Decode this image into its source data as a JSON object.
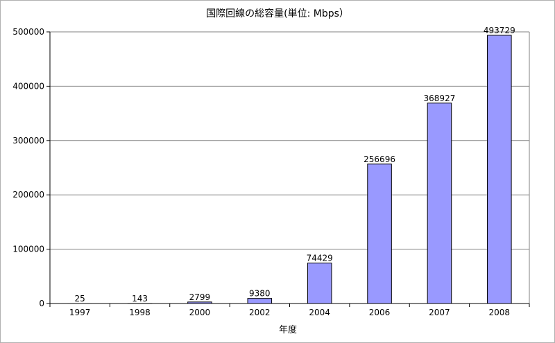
{
  "chart_data": {
    "type": "bar",
    "title": "国際回線の総容量(単位: Mbps）",
    "xlabel": "年度",
    "ylabel": "",
    "categories": [
      "1997",
      "1998",
      "2000",
      "2002",
      "2004",
      "2006",
      "2007",
      "2008"
    ],
    "values": [
      25,
      143,
      2799,
      9380,
      74429,
      256696,
      368927,
      493729
    ],
    "data_labels": [
      "25",
      "143",
      "2799",
      "9380",
      "74429",
      "256696",
      "368927",
      "493729"
    ],
    "ylim": [
      0,
      500000
    ],
    "yticks": [
      0,
      100000,
      200000,
      300000,
      400000,
      500000
    ],
    "ytick_labels": [
      "0",
      "100000",
      "200000",
      "300000",
      "400000",
      "500000"
    ],
    "grid": true,
    "legend": "none",
    "bar_color": "#9999ff",
    "bar_border_color": "#000000"
  }
}
